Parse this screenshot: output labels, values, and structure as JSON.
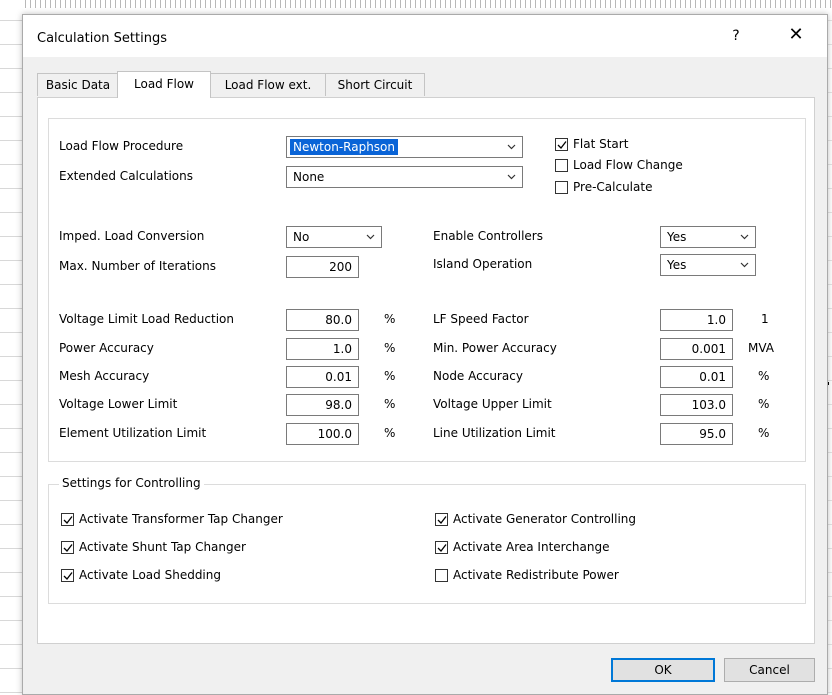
{
  "dialog": {
    "title": "Calculation Settings",
    "help": "?",
    "close": "✕"
  },
  "tabs": [
    {
      "label": "Basic Data",
      "active": false
    },
    {
      "label": "Load Flow",
      "active": true
    },
    {
      "label": "Load Flow ext.",
      "active": false
    },
    {
      "label": "Short Circuit",
      "active": false
    }
  ],
  "load_flow": {
    "procedure": {
      "label": "Load Flow Procedure",
      "value": "Newton-Raphson"
    },
    "extended": {
      "label": "Extended Calculations",
      "value": "None"
    },
    "flat_start": {
      "label": "Flat Start",
      "checked": true
    },
    "lf_change": {
      "label": "Load Flow Change",
      "checked": false
    },
    "pre_calc": {
      "label": "Pre-Calculate",
      "checked": false
    },
    "imped_conv": {
      "label": "Imped. Load Conversion",
      "value": "No"
    },
    "max_iter": {
      "label": "Max. Number of Iterations",
      "value": "200"
    },
    "enable_ctrl": {
      "label": "Enable Controllers",
      "value": "Yes"
    },
    "island_op": {
      "label": "Island Operation",
      "value": "Yes"
    },
    "left_params": [
      {
        "label": "Voltage Limit Load Reduction",
        "value": "80.0",
        "unit": "%"
      },
      {
        "label": "Power Accuracy",
        "value": "1.0",
        "unit": "%"
      },
      {
        "label": "Mesh Accuracy",
        "value": "0.01",
        "unit": "%"
      },
      {
        "label": "Voltage Lower Limit",
        "value": "98.0",
        "unit": "%"
      },
      {
        "label": "Element Utilization Limit",
        "value": "100.0",
        "unit": "%"
      }
    ],
    "right_params": [
      {
        "label": "LF Speed Factor",
        "value": "1.0",
        "unit": "1"
      },
      {
        "label": "Min. Power Accuracy",
        "value": "0.001",
        "unit": "MVA"
      },
      {
        "label": "Node Accuracy",
        "value": "0.01",
        "unit": "%"
      },
      {
        "label": "Voltage Upper Limit",
        "value": "103.0",
        "unit": "%"
      },
      {
        "label": "Line Utilization Limit",
        "value": "95.0",
        "unit": "%"
      }
    ]
  },
  "controlling": {
    "title": "Settings for Controlling",
    "left": [
      {
        "label": "Activate Transformer Tap Changer",
        "checked": true
      },
      {
        "label": "Activate Shunt Tap Changer",
        "checked": true
      },
      {
        "label": "Activate Load Shedding",
        "checked": true
      }
    ],
    "right": [
      {
        "label": "Activate Generator Controlling",
        "checked": true
      },
      {
        "label": "Activate Area Interchange",
        "checked": true
      },
      {
        "label": "Activate Redistribute Power",
        "checked": false
      }
    ]
  },
  "buttons": {
    "ok": "OK",
    "cancel": "Cancel"
  }
}
